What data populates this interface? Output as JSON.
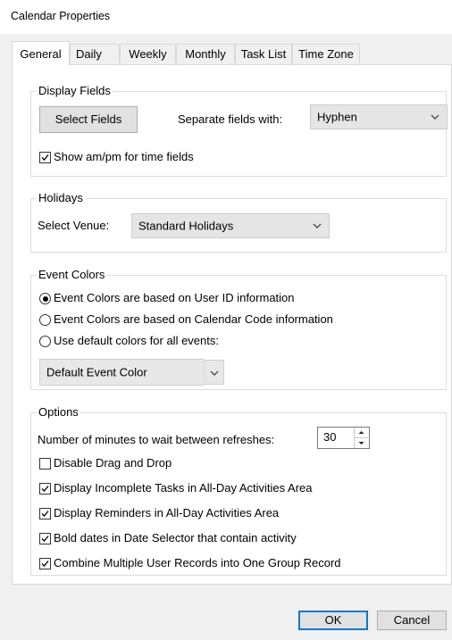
{
  "window": {
    "title": "Calendar Properties"
  },
  "tabs": [
    {
      "label": "General",
      "active": true
    },
    {
      "label": "Daily",
      "active": false
    },
    {
      "label": "Weekly",
      "active": false
    },
    {
      "label": "Monthly",
      "active": false
    },
    {
      "label": "Task List",
      "active": false
    },
    {
      "label": "Time Zone",
      "active": false
    }
  ],
  "display_fields": {
    "legend": "Display Fields",
    "select_fields_label": "Select Fields",
    "separate_label": "Separate fields with:",
    "separator_value": "Hyphen",
    "show_ampm_label": "Show am/pm for time fields",
    "show_ampm_checked": true
  },
  "holidays": {
    "legend": "Holidays",
    "venue_label": "Select Venue:",
    "venue_value": "Standard Holidays"
  },
  "event_colors": {
    "legend": "Event Colors",
    "options": [
      {
        "label": "Event Colors are based on User ID information",
        "selected": true
      },
      {
        "label": "Event Colors are based on Calendar Code information",
        "selected": false
      },
      {
        "label": "Use default colors for all events:",
        "selected": false
      }
    ],
    "default_color_value": "Default Event Color"
  },
  "options": {
    "legend": "Options",
    "refresh_label": "Number of minutes to wait between refreshes:",
    "refresh_value": "30",
    "checkboxes": [
      {
        "label": "Disable Drag and Drop",
        "checked": false
      },
      {
        "label": "Display Incomplete Tasks in All-Day Activities Area",
        "checked": true
      },
      {
        "label": "Display Reminders in All-Day Activities Area",
        "checked": true
      },
      {
        "label": "Bold dates in Date Selector that contain activity",
        "checked": true
      },
      {
        "label": "Combine Multiple User Records into One Group Record",
        "checked": true
      }
    ]
  },
  "footer": {
    "ok_label": "OK",
    "cancel_label": "Cancel"
  }
}
